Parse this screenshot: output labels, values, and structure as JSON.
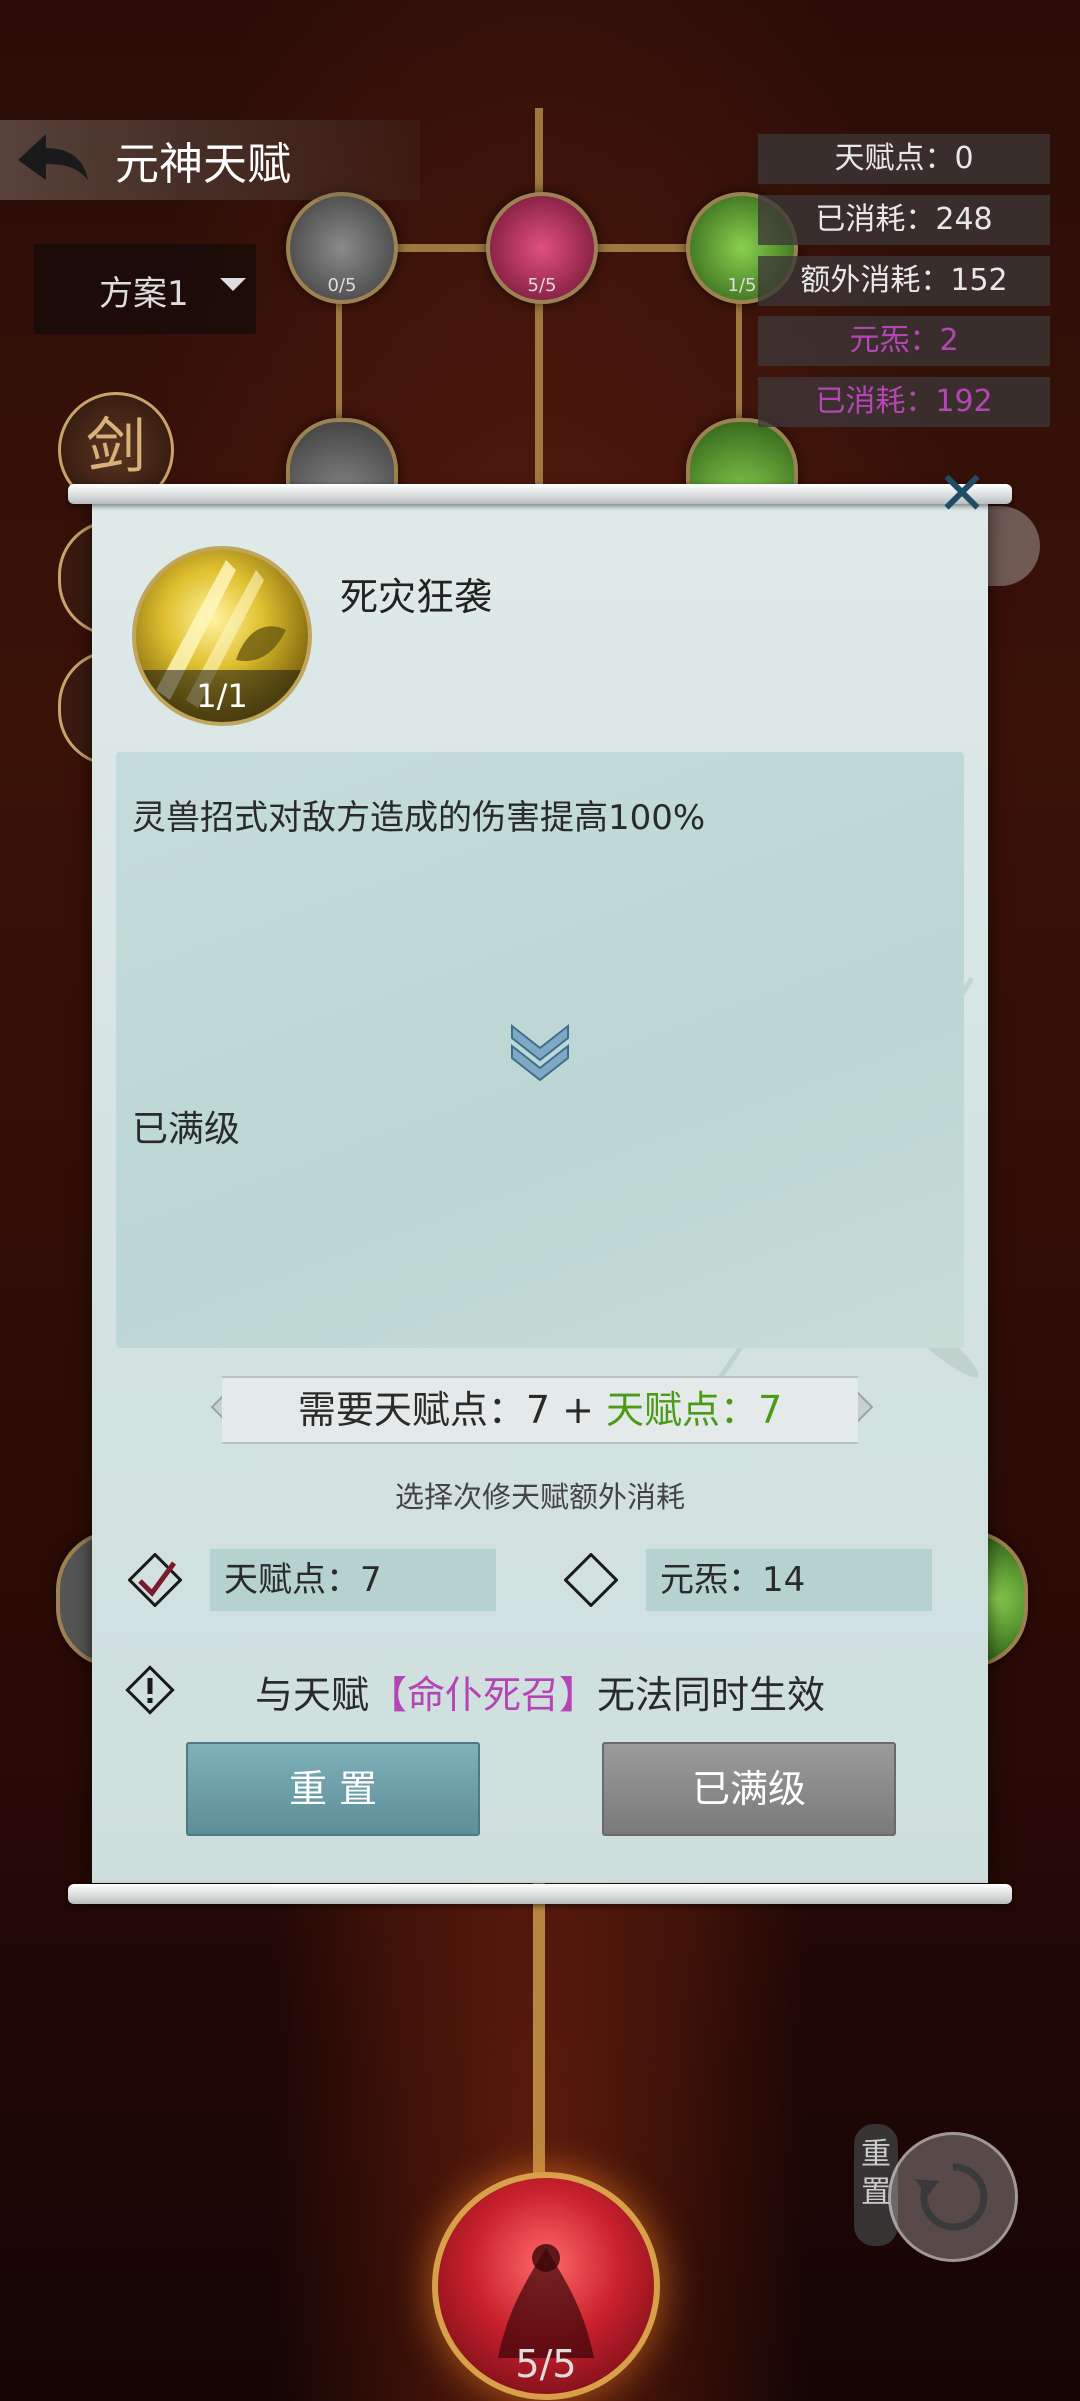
{
  "header": {
    "title": "元神天赋",
    "scheme": "方案1",
    "sword_badge": "剑"
  },
  "stats": {
    "talent_points": "天赋点：0",
    "consumed": "已消耗：248",
    "extra_consumed": "额外消耗：152",
    "yuansha": "元炁：2",
    "yuansha_consumed": "已消耗：192"
  },
  "tree_nodes": {
    "node_a_count": "0/5",
    "node_b_count": "5/5",
    "node_c_count": "1/5",
    "bottom_count": "5/5"
  },
  "modal": {
    "skill_name": "死灾狂袭",
    "skill_level": "1/1",
    "description": "灵兽招式对敌方造成的伤害提高100%",
    "status": "已满级",
    "req_prefix": "需要天赋点：7 + ",
    "req_green": "天赋点：7",
    "extra_title": "选择次修天赋额外消耗",
    "option_talent": "天赋点：7",
    "option_yuansha": "元炁：14",
    "conflict_before": "与天赋",
    "conflict_name": "【命仆死召】",
    "conflict_after": "无法同时生效",
    "btn_reset": "重 置",
    "btn_max": "已满级"
  },
  "bottom": {
    "reset_label": "重置"
  },
  "colors": {
    "green": "#4d9a18",
    "purple": "#b545b5",
    "reset_button": "#6fa0aa"
  }
}
